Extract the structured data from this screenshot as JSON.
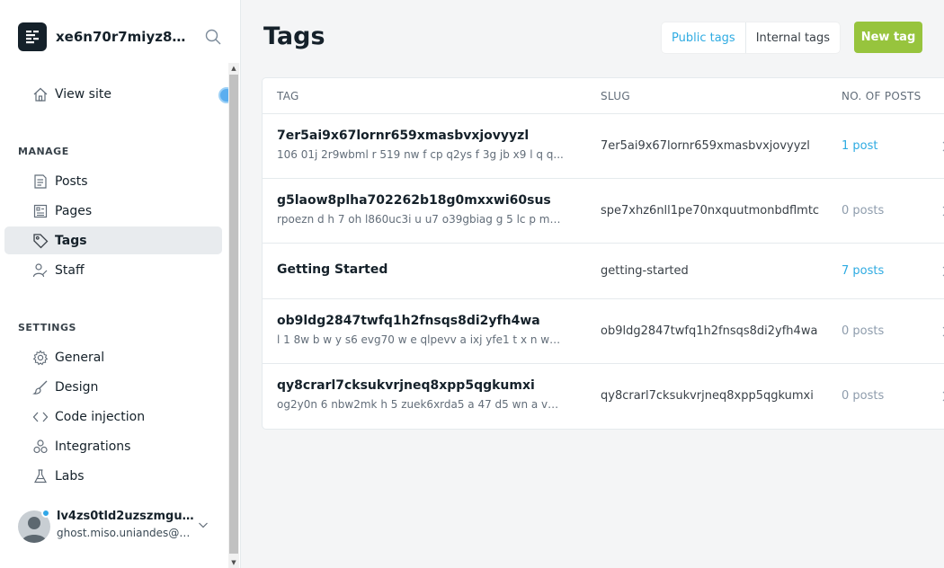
{
  "sidebar": {
    "site_title": "xe6n70r7miyz8hh...",
    "view_site": "View site",
    "manage_label": "MANAGE",
    "manage_items": [
      {
        "label": "Posts",
        "icon": "posts-icon"
      },
      {
        "label": "Pages",
        "icon": "pages-icon"
      },
      {
        "label": "Tags",
        "icon": "tag-icon",
        "active": true
      },
      {
        "label": "Staff",
        "icon": "staff-icon"
      }
    ],
    "settings_label": "SETTINGS",
    "settings_items": [
      {
        "label": "General",
        "icon": "gear-icon"
      },
      {
        "label": "Design",
        "icon": "brush-icon"
      },
      {
        "label": "Code injection",
        "icon": "code-icon"
      },
      {
        "label": "Integrations",
        "icon": "integrations-icon"
      },
      {
        "label": "Labs",
        "icon": "flask-icon"
      }
    ],
    "user": {
      "name": "lv4zs0tld2uzszmguul...",
      "email": "ghost.miso.uniandes@g..."
    }
  },
  "header": {
    "title": "Tags",
    "tabs": [
      {
        "label": "Public tags",
        "active": true
      },
      {
        "label": "Internal tags",
        "active": false
      }
    ],
    "new_button": "New tag"
  },
  "table": {
    "columns": [
      "TAG",
      "SLUG",
      "NO. OF POSTS"
    ],
    "rows": [
      {
        "name": "7er5ai9x67lornr659xmasbvxjovyyzl",
        "description": "106 01j 2r9wbml r 519 nw f cp q2ys f 3g jb x9 l q q...",
        "slug": "7er5ai9x67lornr659xmasbvxjovyyzl",
        "count": "1 post",
        "has_posts": true
      },
      {
        "name": "g5laow8plha702262b18g0mxxwi60sus",
        "description": "rpoezn d h 7 oh l860uc3i u u7 o39gbiag g 5 lc p m8...",
        "slug": "spe7xhz6nll1pe70nxquutmonbdflmtc",
        "count": "0 posts",
        "has_posts": false
      },
      {
        "name": "Getting Started",
        "description": "",
        "slug": "getting-started",
        "count": "7 posts",
        "has_posts": true
      },
      {
        "name": "ob9ldg2847twfq1h2fnsqs8di2yfh4wa",
        "description": "l 1 8w b w y s6 evg70 w e qlpevv a ixj yfe1 t x n wp...",
        "slug": "ob9ldg2847twfq1h2fnsqs8di2yfh4wa",
        "count": "0 posts",
        "has_posts": false
      },
      {
        "name": "qy8crarl7cksukvrjneq8xpp5qgkumxi",
        "description": "og2y0n 6 nbw2mk h 5 zuek6xrda5 a 47 d5 wn a vg ...",
        "slug": "qy8crarl7cksukvrjneq8xpp5qgkumxi",
        "count": "0 posts",
        "has_posts": false
      }
    ]
  },
  "colors": {
    "accent": "#2eabe2",
    "primary_button": "#97c43d",
    "sidebar_active": "#e8ebee"
  }
}
